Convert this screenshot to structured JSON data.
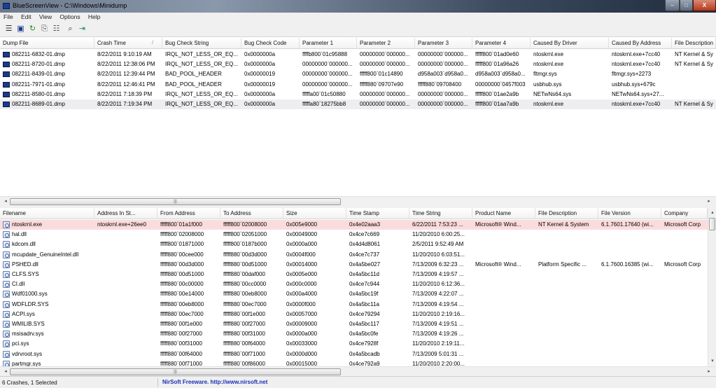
{
  "window": {
    "title": "BlueScreenView  -  C:\\Windows\\Minidump",
    "min_label": "–",
    "max_label": "□",
    "close_label": "X"
  },
  "menu": [
    "File",
    "Edit",
    "View",
    "Options",
    "Help"
  ],
  "toolbar": [
    {
      "icon": "properties-icon",
      "glyph": "☰"
    },
    {
      "icon": "save-icon",
      "glyph": "▣"
    },
    {
      "icon": "refresh-icon",
      "glyph": "↻"
    },
    {
      "icon": "copy-icon",
      "glyph": "⎘"
    },
    {
      "icon": "properties-sheet-icon",
      "glyph": "☷"
    },
    {
      "icon": "find-icon",
      "glyph": "⌕"
    },
    {
      "icon": "exit-icon",
      "glyph": "⇥"
    }
  ],
  "dumps": {
    "columns": [
      "Dump File",
      "Crash Time",
      "Bug Check String",
      "Bug Check Code",
      "Parameter 1",
      "Parameter 2",
      "Parameter 3",
      "Parameter 4",
      "Caused By Driver",
      "Caused By Address",
      "File Description"
    ],
    "sort_indicator": "/",
    "rows": [
      [
        "082211-6832-01.dmp",
        "8/22/2011 9:10:19 AM",
        "IRQL_NOT_LESS_OR_EQ...",
        "0x0000000a",
        "ffffb800`01c95888",
        "00000000`000000...",
        "00000000`000000...",
        "fffff800`01ad0e60",
        "ntoskrnl.exe",
        "ntoskrnl.exe+7cc40",
        "NT Kernel & Sy"
      ],
      [
        "082211-8720-01.dmp",
        "8/22/2011 12:38:06 PM",
        "IRQL_NOT_LESS_OR_EQ...",
        "0x0000000a",
        "00000000`000000...",
        "00000000`000000...",
        "00000000`000000...",
        "fffff800`01a96a26",
        "ntoskrnl.exe",
        "ntoskrnl.exe+7cc40",
        "NT Kernel & Sy"
      ],
      [
        "082211-8439-01.dmp",
        "8/22/2011 12:39:44 PM",
        "BAD_POOL_HEADER",
        "0x00000019",
        "00000000`000000...",
        "fffff800`01c14890",
        "d958a003`d958a0...",
        "d958a003`d958a0...",
        "fltmgr.sys",
        "fltmgr.sys+2273",
        ""
      ],
      [
        "082211-7971-01.dmp",
        "8/22/2011 12:46:41 PM",
        "BAD_POOL_HEADER",
        "0x00000019",
        "00000000`000000...",
        "fffff880`09707e90",
        "fffff880`09708400",
        "00000000`0457f003",
        "usbhub.sys",
        "usbhub.sys+679c",
        ""
      ],
      [
        "082211-8580-01.dmp",
        "8/22/2011 7:18:39 PM",
        "IRQL_NOT_LESS_OR_EQ...",
        "0x0000000a",
        "fffffa00`01c50880",
        "00000000`000000...",
        "00000000`000000...",
        "fffff800`01ae2a9b",
        "NETwNs64.sys",
        "NETwNs64.sys+27...",
        ""
      ],
      [
        "082211-8689-01.dmp",
        "8/22/2011 7:19:34 PM",
        "IRQL_NOT_LESS_OR_EQ...",
        "0x0000000a",
        "fffffa80`18275bb8",
        "00000000`000000...",
        "00000000`000000...",
        "fffff800`01aa7a9b",
        "ntoskrnl.exe",
        "ntoskrnl.exe+7cc40",
        "NT Kernel & Sy"
      ]
    ],
    "selected_row": 5
  },
  "modules": {
    "columns": [
      "Filename",
      "Address In St...",
      "From Address",
      "To Address",
      "Size",
      "Time Stamp",
      "Time String",
      "Product Name",
      "File Description",
      "File Version",
      "Company"
    ],
    "sort_indicator": "/",
    "rows": [
      [
        "ntoskrnl.exe",
        "ntoskrnl.exe+26ee0",
        "fffff800`01a1f000",
        "fffff800`02008000",
        "0x005e9000",
        "0x4e02aaa3",
        "6/22/2011 7:53:23 ...",
        "Microsoft® Wind...",
        "NT Kernel & System",
        "6.1.7601.17640 (wi...",
        "Microsoft Corp"
      ],
      [
        "hal.dll",
        "",
        "fffff800`02008000",
        "fffff800`02051000",
        "0x00049000",
        "0x4ce7c669",
        "11/20/2010 6:00:25...",
        "",
        "",
        "",
        ""
      ],
      [
        "kdcom.dll",
        "",
        "fffff800`01871000",
        "fffff800`0187b000",
        "0x0000a000",
        "0x4d4d8061",
        "2/5/2011 9:52:49 AM",
        "",
        "",
        "",
        ""
      ],
      [
        "mcupdate_GenuineIntel.dll",
        "",
        "fffff880`00cee000",
        "fffff880`00d3d000",
        "0x0004f000",
        "0x4ce7c737",
        "11/20/2010 6:03:51...",
        "",
        "",
        "",
        ""
      ],
      [
        "PSHED.dll",
        "",
        "fffff880`00d3d000",
        "fffff880`00d51000",
        "0x00014000",
        "0x4a5be027",
        "7/13/2009 6:32:23 ...",
        "Microsoft® Wind...",
        "Platform Specific ...",
        "6.1.7600.16385 (wi...",
        "Microsoft Corp"
      ],
      [
        "CLFS.SYS",
        "",
        "fffff880`00d51000",
        "fffff880`00daf000",
        "0x0005e000",
        "0x4a5bc11d",
        "7/13/2009 4:19:57 ...",
        "",
        "",
        "",
        ""
      ],
      [
        "CI.dll",
        "",
        "fffff880`00c00000",
        "fffff880`00cc0000",
        "0x000c0000",
        "0x4ce7c944",
        "11/20/2010 6:12:36...",
        "",
        "",
        "",
        ""
      ],
      [
        "Wdf01000.sys",
        "",
        "fffff880`00e14000",
        "fffff880`00eb8000",
        "0x000a4000",
        "0x4a5bc19f",
        "7/13/2009 4:22:07 ...",
        "",
        "",
        "",
        ""
      ],
      [
        "WDFLDR.SYS",
        "",
        "fffff880`00eb8000",
        "fffff880`00ec7000",
        "0x0000f000",
        "0x4a5bc11a",
        "7/13/2009 4:19:54 ...",
        "",
        "",
        "",
        ""
      ],
      [
        "ACPI.sys",
        "",
        "fffff880`00ec7000",
        "fffff880`00f1e000",
        "0x00057000",
        "0x4ce79294",
        "11/20/2010 2:19:16...",
        "",
        "",
        "",
        ""
      ],
      [
        "WMILIB.SYS",
        "",
        "fffff880`00f1e000",
        "fffff880`00f27000",
        "0x00009000",
        "0x4a5bc117",
        "7/13/2009 4:19:51 ...",
        "",
        "",
        "",
        ""
      ],
      [
        "msisadrv.sys",
        "",
        "fffff880`00f27000",
        "fffff880`00f31000",
        "0x0000a000",
        "0x4a5bc0fe",
        "7/13/2009 4:19:26 ...",
        "",
        "",
        "",
        ""
      ],
      [
        "pci.sys",
        "",
        "fffff880`00f31000",
        "fffff880`00f64000",
        "0x00033000",
        "0x4ce7928f",
        "11/20/2010 2:19:11...",
        "",
        "",
        "",
        ""
      ],
      [
        "vdrvroot.sys",
        "",
        "fffff880`00f64000",
        "fffff880`00f71000",
        "0x0000d000",
        "0x4a5bcadb",
        "7/13/2009 5:01:31 ...",
        "",
        "",
        "",
        ""
      ],
      [
        "partmgr.sys",
        "",
        "fffff880`00f71000",
        "fffff880`00f86000",
        "0x00015000",
        "0x4ce792a9",
        "11/20/2010 2:20:00...",
        "",
        "",
        "",
        ""
      ]
    ],
    "highlighted_row": 0
  },
  "scroll": {
    "left_arrow": "◂",
    "right_arrow": "▸",
    "up_arrow": "▴",
    "down_arrow": "▾",
    "grip": "|||"
  },
  "status": {
    "count": "6 Crashes, 1 Selected",
    "link": "NirSoft Freeware.  http://www.nirsoft.net"
  },
  "colors": {
    "highlight_row": "#fbdcdc",
    "selected_row": "#eeeef0",
    "link": "#1c2fb8"
  }
}
